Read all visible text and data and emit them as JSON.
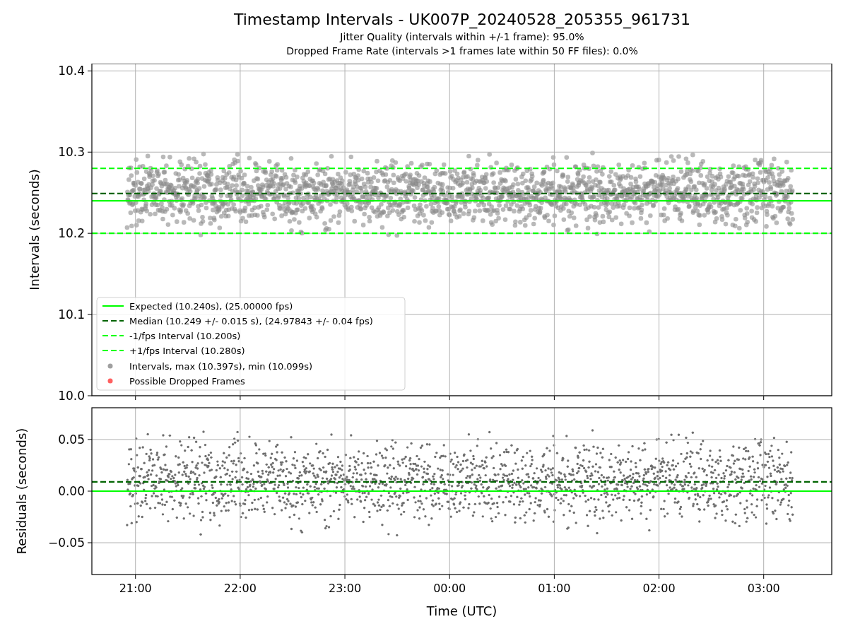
{
  "figure": {
    "title": "Timestamp Intervals - UK007P_20240528_205355_961731",
    "subtitles": [
      "Jitter Quality (intervals within +/-1 frame): 95.0%",
      "Dropped Frame Rate (intervals >1 frames late within 50 FF files): 0.0%"
    ]
  },
  "top_panel": {
    "chart_data": {
      "type": "line",
      "ylabel": "Intervals (seconds)",
      "grid": true,
      "legend": true,
      "xlim": [
        "2024-05-28 20:35",
        "2024-05-29 03:39"
      ],
      "ylim": [
        10.0,
        10.409
      ],
      "yticks": [
        {
          "value": 10.0,
          "label": "10.0"
        },
        {
          "value": 10.1,
          "label": "10.1"
        },
        {
          "value": 10.2,
          "label": "10.2"
        },
        {
          "value": 10.3,
          "label": "10.3"
        },
        {
          "value": 10.4,
          "label": "10.4"
        }
      ],
      "x": [
        "2024-05-28 20:35",
        "2024-05-29 03:39"
      ],
      "series": [
        {
          "name": "Expected (10.240s), (25.00000 fps)",
          "color": "#00ff00",
          "line_style": "solid",
          "values": [
            10.24,
            10.24
          ]
        },
        {
          "name": "Median (10.249 +/- 0.015 s), (24.97843 +/- 0.04 fps)",
          "color": "#006400",
          "line_style": "dashed",
          "values": [
            10.249,
            10.249
          ]
        },
        {
          "name": "-1/fps Interval (10.200s)",
          "color": "#00ff00",
          "line_style": "dashed",
          "values": [
            10.2,
            10.2
          ]
        },
        {
          "name": "+1/fps Interval (10.280s)",
          "color": "#00ff00",
          "line_style": "dashed",
          "values": [
            10.28,
            10.28
          ]
        }
      ]
    },
    "legend_markers": [
      {
        "label": "Intervals, max (10.397s), min (10.099s)",
        "color": "#a0a0a0"
      },
      {
        "label": "Possible Dropped Frames",
        "color": "#ff6060"
      }
    ]
  },
  "bottom_panel": {
    "chart_data": {
      "type": "line",
      "xlabel": "Time (UTC)",
      "ylabel": "Residuals (seconds)",
      "grid": true,
      "xlim": [
        "2024-05-28 20:35",
        "2024-05-29 03:39"
      ],
      "ylim": [
        -0.0808,
        0.0808
      ],
      "xticks": [
        {
          "value": "2024-05-28 21:00",
          "label": "21:00"
        },
        {
          "value": "2024-05-28 22:00",
          "label": "22:00"
        },
        {
          "value": "2024-05-28 23:00",
          "label": "23:00"
        },
        {
          "value": "2024-05-29 00:00",
          "label": "00:00"
        },
        {
          "value": "2024-05-29 01:00",
          "label": "01:00"
        },
        {
          "value": "2024-05-29 02:00",
          "label": "02:00"
        },
        {
          "value": "2024-05-29 03:00",
          "label": "03:00"
        }
      ],
      "yticks": [
        {
          "value": 0.05,
          "label": "0.05"
        },
        {
          "value": 0,
          "label": "0.00"
        },
        {
          "value": -0.05,
          "label": "−0.05"
        }
      ],
      "x": [
        "2024-05-28 20:35",
        "2024-05-29 03:39"
      ],
      "series": [
        {
          "color": "#00ff00",
          "line_style": "solid",
          "values": [
            0,
            0
          ]
        },
        {
          "color": "#006400",
          "line_style": "dashed",
          "values": [
            0.009,
            0.009
          ]
        }
      ]
    }
  }
}
